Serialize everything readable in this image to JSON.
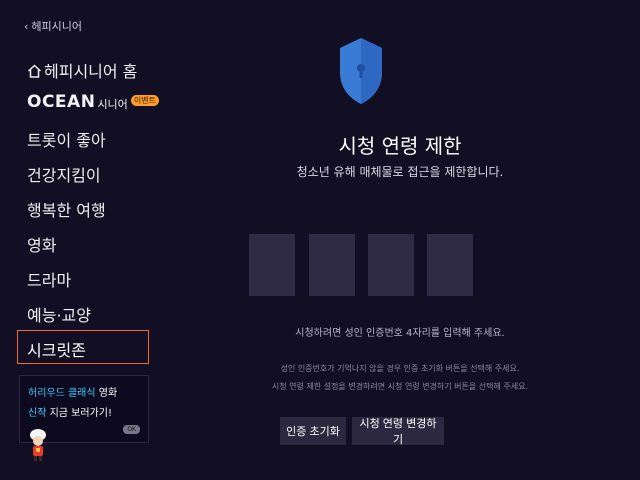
{
  "sidebar": {
    "back_label": "헤피시니어",
    "home_label": "헤피시니어 홈",
    "ocean": {
      "logo": "OCEAN",
      "sub": "시니어",
      "badge": "이벤트"
    },
    "items": [
      "트롯이 좋아",
      "건강지킴이",
      "행복한 여행",
      "영화",
      "드라마",
      "예능·교양"
    ],
    "selected": "시크릿존",
    "promo": {
      "line1_highlight": "허리우드 클래식",
      "line1_rest": " 영화",
      "line2_highlight": "신작",
      "line2_rest": " 지금 보러가기!",
      "ok": "OK"
    }
  },
  "main": {
    "title": "시청 연령 제한",
    "subtitle": "청소년 유해 매체물로 접근을 제한합니다.",
    "hint": "시청하려면 성인 인증번호 4자리를 입력해 주세요.",
    "note1": "성인 인증번호가 기억나지 않을 경우 인증 초기화 버튼을 선택해 주세요.",
    "note2": "시청 연령 제한 설정을 변경하려면 시청 연령 변경하기 버튼을 선택해 주세요.",
    "btn_reset": "인증 초기화",
    "btn_change": "시청 연령 변경하기"
  },
  "colors": {
    "background": "#120f25",
    "accent": "#f06a33",
    "highlight": "#3ec9ff",
    "shield": "#3a7bd5"
  }
}
